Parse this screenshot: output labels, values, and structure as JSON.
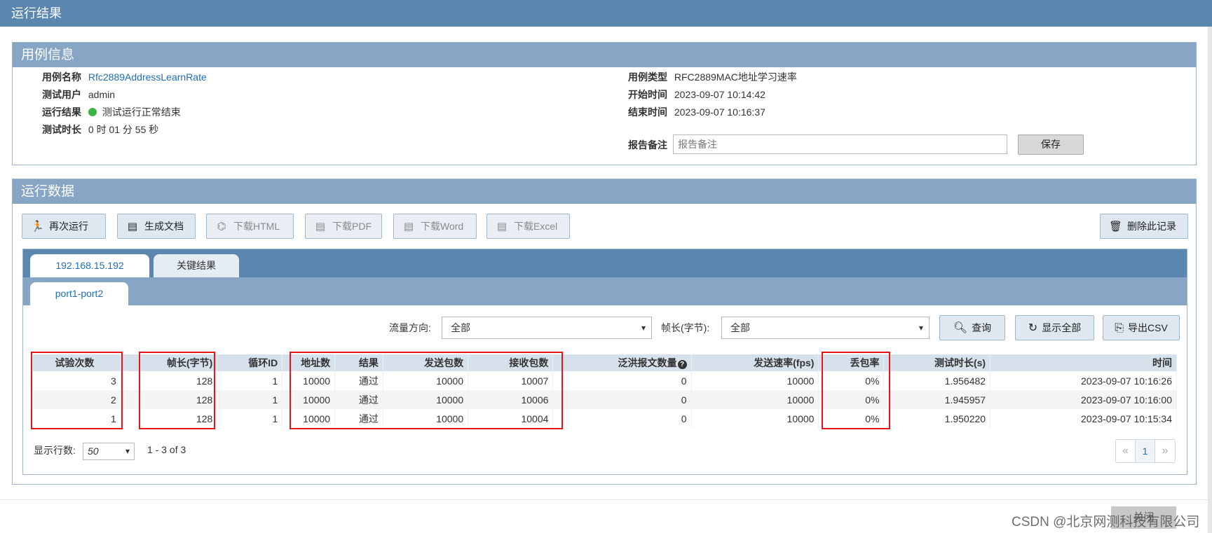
{
  "window": {
    "title": "运行结果"
  },
  "case_info": {
    "header": "用例信息",
    "name_label": "用例名称",
    "name_value": "Rfc2889AddressLearnRate",
    "user_label": "测试用户",
    "user_value": "admin",
    "result_label": "运行结果",
    "result_value": "测试运行正常结束",
    "duration_label": "测试时长",
    "duration_value": "0 时 01 分 55 秒",
    "type_label": "用例类型",
    "type_value": "RFC2889MAC地址学习速率",
    "start_label": "开始时间",
    "start_value": "2023-09-07 10:14:42",
    "end_label": "结束时间",
    "end_value": "2023-09-07 10:16:37",
    "note_label": "报告备注",
    "note_placeholder": "报告备注",
    "save_label": "保存",
    "status_color": "#3bb54a"
  },
  "run_data": {
    "header": "运行数据",
    "toolbar": {
      "rerun": "再次运行",
      "gen_doc": "生成文档",
      "dl_html": "下载HTML",
      "dl_pdf": "下载PDF",
      "dl_word": "下载Word",
      "dl_excel": "下载Excel",
      "delete": "删除此记录"
    },
    "tabs": [
      "192.168.15.192",
      "关键结果"
    ],
    "subtabs": [
      "port1-port2"
    ],
    "filters": {
      "direction_label": "流量方向:",
      "direction_value": "全部",
      "frame_label": "帧长(字节):",
      "frame_value": "全部",
      "query": "查询",
      "show_all": "显示全部",
      "export_csv": "导出CSV"
    },
    "table": {
      "columns": [
        "试验次数",
        "帧长(字节)",
        "循环ID",
        "地址数",
        "结果",
        "发送包数",
        "接收包数",
        "泛洪报文数量",
        "发送速率(fps)",
        "丢包率",
        "测试时长(s)",
        "时间"
      ],
      "rows": [
        [
          "3",
          "128",
          "1",
          "10000",
          "通过",
          "10000",
          "10007",
          "0",
          "10000",
          "0%",
          "1.956482",
          "2023-09-07 10:16:26"
        ],
        [
          "2",
          "128",
          "1",
          "10000",
          "通过",
          "10000",
          "10006",
          "0",
          "10000",
          "0%",
          "1.945957",
          "2023-09-07 10:16:00"
        ],
        [
          "1",
          "128",
          "1",
          "10000",
          "通过",
          "10000",
          "10004",
          "0",
          "10000",
          "0%",
          "1.950220",
          "2023-09-07 10:15:34"
        ]
      ]
    },
    "pagination": {
      "rows_label": "显示行数:",
      "rows_value": "50",
      "info": "1 - 3 of 3",
      "current_page": "1"
    }
  },
  "footer": {
    "close": "关闭",
    "watermark": "CSDN @北京网测科技有限公司"
  },
  "colors": {
    "title_bar": "#5b86b0",
    "panel_header": "#87a6c6",
    "highlight": "#e3161b",
    "link": "#1f6fb7"
  }
}
